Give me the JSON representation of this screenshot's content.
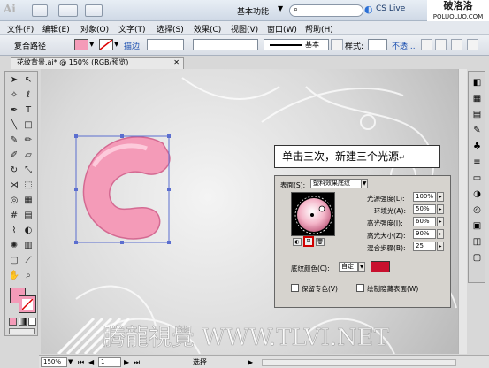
{
  "title_bar": {
    "app_logo": "Ai",
    "workspace": "基本功能",
    "cs_live": "CS Live",
    "watermark_title": "破洛洛",
    "watermark_url": "POLUOLUO.COM"
  },
  "menu": [
    "文件(F)",
    "编辑(E)",
    "对象(O)",
    "文字(T)",
    "选择(S)",
    "效果(C)",
    "视图(V)",
    "窗口(W)",
    "帮助(H)"
  ],
  "control_bar": {
    "object_type": "复合路径",
    "stroke_label": "描边:",
    "stroke_style": "基本",
    "style_label": "样式:",
    "opacity_label": "不透..."
  },
  "document": {
    "tab": "花纹背景.ai* @ 150% (RGB/预览)"
  },
  "callout": {
    "text": "单击三次，新建三个光源"
  },
  "panel": {
    "surface_label": "表面(S):",
    "surface_value": "塑料效果底纹",
    "light_intensity_label": "光源强度(L):",
    "light_intensity": "100%",
    "ambient_label": "环境光(A):",
    "ambient": "50%",
    "highlight_intensity_label": "高光强度(I):",
    "highlight_intensity": "60%",
    "highlight_size_label": "高光大小(Z):",
    "highlight_size": "90%",
    "blend_steps_label": "混合步骤(B):",
    "blend_steps": "25",
    "shading_label": "底纹颜色(C):",
    "shading_value": "自定",
    "preserve_label": "保留专色(V)",
    "draw_hidden_label": "绘制隐藏表面(W)"
  },
  "colors": {
    "fill": "#f49bb8",
    "shading": "#c8102e",
    "highlight_box": "#d00000"
  },
  "status": {
    "zoom": "150%",
    "page": "1",
    "mode": "选择"
  },
  "canvas_watermark": "腾龍視覺 WWW.TLVI.NET"
}
